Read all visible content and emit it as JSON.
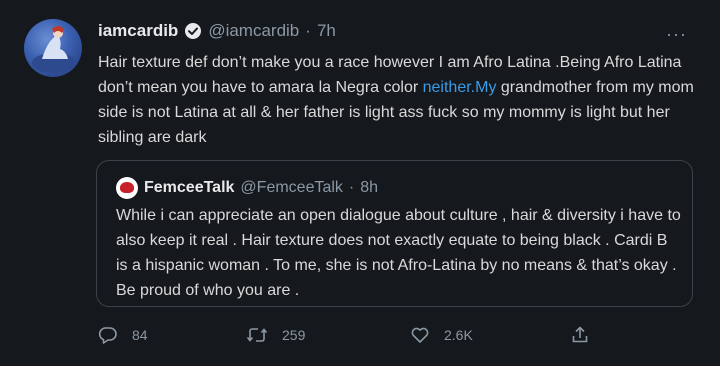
{
  "tweet": {
    "display_name": "iamcardib",
    "handle": "@iamcardib",
    "separator": "·",
    "time": "7h",
    "more_label": "···",
    "text_before_link": "Hair texture def don’t make you a race however I am Afro Latina .Being Afro Latina don’t mean you have to amara la Negra color ",
    "link_text": "neither.My",
    "text_after_link": " grandmother from my mom side is not Latina at all & her father is light ass fuck so my mommy is light but her sibling are dark"
  },
  "quote": {
    "display_name": "FemceeTalk",
    "handle": "@FemceeTalk",
    "separator": "·",
    "time": "8h",
    "text": "While i can appreciate an open dialogue about culture , hair & diversity i have to also keep it real . Hair texture does not exactly equate to being black . Cardi B is a hispanic woman . To me, she is not Afro-Latina by no means & that’s okay . Be proud of who you are ."
  },
  "actions": {
    "reply_count": "84",
    "retweet_count": "259",
    "like_count": "2.6K"
  },
  "icons": {
    "verified": "verified-badge-icon",
    "reply": "reply-icon",
    "retweet": "retweet-icon",
    "like": "heart-icon",
    "share": "share-icon",
    "more": "more-options-icon"
  },
  "colors": {
    "background": "#15181c",
    "link": "#3a9be6",
    "muted": "#8b98a5"
  }
}
